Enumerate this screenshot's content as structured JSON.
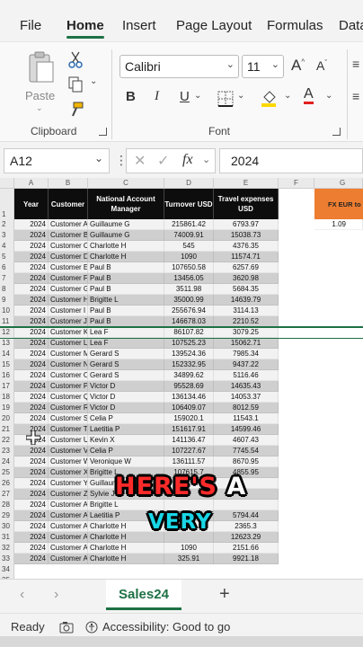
{
  "menu": {
    "tabs": [
      "File",
      "Home",
      "Insert",
      "Page Layout",
      "Formulas",
      "Data"
    ],
    "active": "Home"
  },
  "ribbon": {
    "clipboard_label": "Clipboard",
    "paste_label": "Paste",
    "font_label": "Font",
    "font_name": "Calibri",
    "font_size": "11",
    "bold": "B",
    "italic": "I",
    "underline": "U",
    "grow_font": "A",
    "shrink_font": "A",
    "font_color": "A"
  },
  "formula_bar": {
    "name_box": "A12",
    "fx": "fx",
    "value": "2024"
  },
  "grid": {
    "columns": [
      "A",
      "B",
      "C",
      "D",
      "E",
      "F",
      "G"
    ],
    "headers": [
      "Year",
      "Customer",
      "National Account Manager",
      "Turnover USD",
      "Travel expenses USD"
    ],
    "fx_header": "FX EUR to",
    "fx_value": "1.09",
    "rows": [
      [
        "2024",
        "Customer A",
        "Guillaume G",
        "215861.42",
        "6793.97"
      ],
      [
        "2024",
        "Customer B",
        "Guillaume G",
        "74009.91",
        "15038.73"
      ],
      [
        "2024",
        "Customer C",
        "Charlotte H",
        "545",
        "4376.35"
      ],
      [
        "2024",
        "Customer D",
        "Charlotte H",
        "1090",
        "11574.71"
      ],
      [
        "2024",
        "Customer E",
        "Paul B",
        "107650.58",
        "6257.69"
      ],
      [
        "2024",
        "Customer F",
        "Paul B",
        "13456.05",
        "3620.98"
      ],
      [
        "2024",
        "Customer G",
        "Paul B",
        "3511.98",
        "5684.35"
      ],
      [
        "2024",
        "Customer H",
        "Brigitte L",
        "35000.99",
        "14639.79"
      ],
      [
        "2024",
        "Customer I",
        "Paul B",
        "255676.94",
        "3114.13"
      ],
      [
        "2024",
        "Customer J",
        "Paul B",
        "146678.03",
        "2210.52"
      ],
      [
        "2024",
        "Customer K",
        "Lea F",
        "86107.82",
        "3079.25"
      ],
      [
        "2024",
        "Customer L",
        "Lea F",
        "107525.23",
        "15062.71"
      ],
      [
        "2024",
        "Customer M",
        "Gerard S",
        "139524.36",
        "7985.34"
      ],
      [
        "2024",
        "Customer N",
        "Gerard S",
        "152332.95",
        "9437.22"
      ],
      [
        "2024",
        "Customer O",
        "Gerard S",
        "34899.62",
        "5116.46"
      ],
      [
        "2024",
        "Customer P",
        "Victor D",
        "95528.69",
        "14635.43"
      ],
      [
        "2024",
        "Customer Q",
        "Victor D",
        "136134.46",
        "14053.37"
      ],
      [
        "2024",
        "Customer R",
        "Victor D",
        "106409.07",
        "8012.59"
      ],
      [
        "2024",
        "Customer S",
        "Celia P",
        "159020.1",
        "11543.1"
      ],
      [
        "2024",
        "Customer T",
        "Laetitia P",
        "151617.91",
        "14599.46"
      ],
      [
        "2024",
        "Customer U",
        "Kevin X",
        "141136.47",
        "4607.43"
      ],
      [
        "2024",
        "Customer V",
        "Celia P",
        "107227.67",
        "7745.54"
      ],
      [
        "2024",
        "Customer W",
        "Veronique W",
        "136111.57",
        "8670.95"
      ],
      [
        "2024",
        "Customer X",
        "Brigitte L",
        "107615.7",
        "4855.95"
      ],
      [
        "2024",
        "Customer Y",
        "Guillaume G",
        "",
        ""
      ],
      [
        "2024",
        "Customer Z",
        "Sylvie J",
        "",
        ""
      ],
      [
        "2024",
        "Customer AA",
        "Brigitte L",
        "",
        ""
      ],
      [
        "2024",
        "Customer AB",
        "Laetitia P",
        "",
        "5794.44"
      ],
      [
        "2024",
        "Customer AC",
        "Charlotte H",
        "",
        "2365.3"
      ],
      [
        "2024",
        "Customer AD",
        "Charlotte H",
        "",
        "12623.29"
      ],
      [
        "2024",
        "Customer AE",
        "Charlotte H",
        "1090",
        "2151.66"
      ],
      [
        "2024",
        "Customer AF",
        "Charlotte H",
        "325.91",
        "9921.18"
      ]
    ]
  },
  "sheets": {
    "active": "Sales24",
    "add": "+"
  },
  "status": {
    "ready": "Ready",
    "accessibility": "Accessibility: Good to go"
  },
  "overlay": {
    "line1_a": "HERE'S",
    "line1_b": "A",
    "line2": "VERY"
  },
  "colors": {
    "accent": "#1e7145",
    "header_bg": "#0d0d0d",
    "fx_header_bg": "#ed7d31",
    "row_shade": "#cfcfcf"
  }
}
